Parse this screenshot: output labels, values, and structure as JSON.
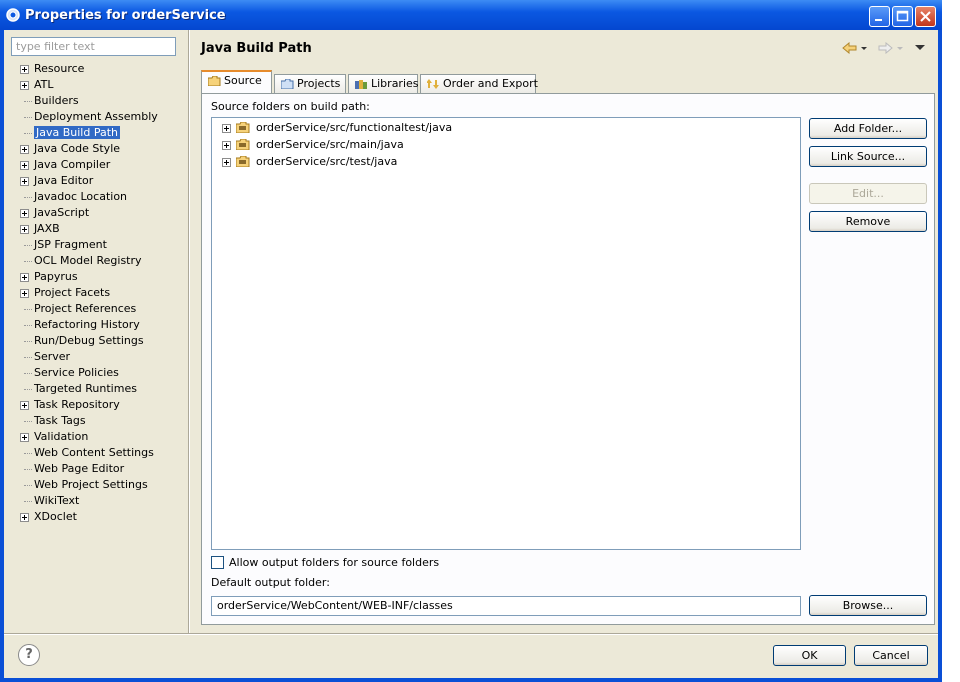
{
  "window": {
    "title": "Properties for orderService"
  },
  "filter": {
    "placeholder": "type filter text"
  },
  "tree": {
    "items": [
      {
        "label": "Resource",
        "expandable": true
      },
      {
        "label": "ATL",
        "expandable": true
      },
      {
        "label": "Builders",
        "expandable": false
      },
      {
        "label": "Deployment Assembly",
        "expandable": false
      },
      {
        "label": "Java Build Path",
        "expandable": false,
        "selected": true
      },
      {
        "label": "Java Code Style",
        "expandable": true
      },
      {
        "label": "Java Compiler",
        "expandable": true
      },
      {
        "label": "Java Editor",
        "expandable": true
      },
      {
        "label": "Javadoc Location",
        "expandable": false
      },
      {
        "label": "JavaScript",
        "expandable": true
      },
      {
        "label": "JAXB",
        "expandable": true
      },
      {
        "label": "JSP Fragment",
        "expandable": false
      },
      {
        "label": "OCL Model Registry",
        "expandable": false
      },
      {
        "label": "Papyrus",
        "expandable": true
      },
      {
        "label": "Project Facets",
        "expandable": true
      },
      {
        "label": "Project References",
        "expandable": false
      },
      {
        "label": "Refactoring History",
        "expandable": false
      },
      {
        "label": "Run/Debug Settings",
        "expandable": false
      },
      {
        "label": "Server",
        "expandable": false
      },
      {
        "label": "Service Policies",
        "expandable": false
      },
      {
        "label": "Targeted Runtimes",
        "expandable": false
      },
      {
        "label": "Task Repository",
        "expandable": true
      },
      {
        "label": "Task Tags",
        "expandable": false
      },
      {
        "label": "Validation",
        "expandable": true
      },
      {
        "label": "Web Content Settings",
        "expandable": false
      },
      {
        "label": "Web Page Editor",
        "expandable": false
      },
      {
        "label": "Web Project Settings",
        "expandable": false
      },
      {
        "label": "WikiText",
        "expandable": false
      },
      {
        "label": "XDoclet",
        "expandable": true
      }
    ]
  },
  "page": {
    "title": "Java Build Path"
  },
  "tabs": [
    {
      "label": "Source",
      "active": true
    },
    {
      "label": "Projects",
      "active": false
    },
    {
      "label": "Libraries",
      "active": false
    },
    {
      "label": "Order and Export",
      "active": false
    }
  ],
  "source": {
    "list_label": "Source folders on build path:",
    "folders": [
      "orderService/src/functionaltest/java",
      "orderService/src/main/java",
      "orderService/src/test/java"
    ],
    "buttons": {
      "add_folder": "Add Folder...",
      "link_source": "Link Source...",
      "edit": "Edit...",
      "remove": "Remove",
      "browse": "Browse..."
    },
    "allow_output_label": "Allow output folders for source folders",
    "allow_output_checked": false,
    "default_output_label": "Default output folder:",
    "default_output_value": "orderService/WebContent/WEB-INF/classes"
  },
  "footer": {
    "help_glyph": "?",
    "ok": "OK",
    "cancel": "Cancel"
  },
  "colors": {
    "titlebar": "#0b58e2",
    "selection": "#316ac5",
    "active_tab_accent": "#e68b2c"
  }
}
